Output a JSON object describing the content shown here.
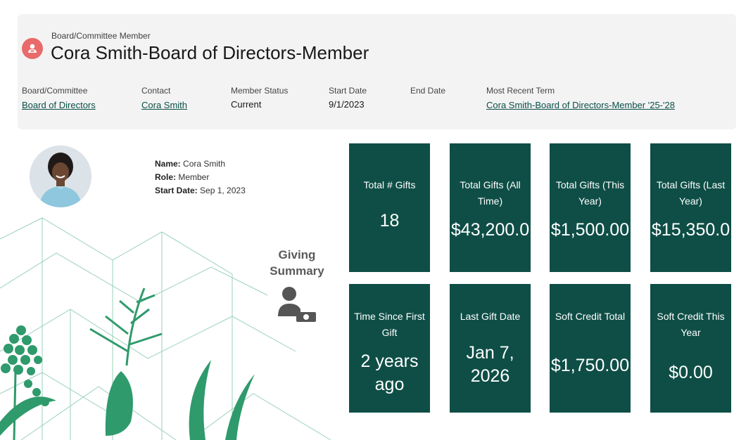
{
  "header": {
    "object_type": "Board/Committee Member",
    "title": "Cora Smith-Board of Directors-Member",
    "fields": [
      {
        "label": "Board/Committee",
        "value": "Board of Directors",
        "link": true
      },
      {
        "label": "Contact",
        "value": "Cora Smith",
        "link": true
      },
      {
        "label": "Member Status",
        "value": "Current",
        "link": false
      },
      {
        "label": "Start Date",
        "value": "9/1/2023",
        "link": false
      },
      {
        "label": "End Date",
        "value": "",
        "link": false
      },
      {
        "label": "Most Recent Term",
        "value": "Cora Smith-Board of Directors-Member '25-'28",
        "link": true
      }
    ]
  },
  "profile": {
    "name_label": "Name:",
    "name": "Cora Smith",
    "role_label": "Role:",
    "role": "Member",
    "start_label": "Start Date:",
    "start": "Sep 1, 2023"
  },
  "giving_summary": {
    "title_line1": "Giving",
    "title_line2": "Summary",
    "tiles": [
      {
        "label": "Total # Gifts",
        "value": "18"
      },
      {
        "label": "Total Gifts (All Time)",
        "value": "$43,200.0"
      },
      {
        "label": "Total Gifts (This Year)",
        "value": "$1,500.00"
      },
      {
        "label": "Total Gifts (Last Year)",
        "value": "$15,350.0"
      },
      {
        "label": "Time Since First Gift",
        "value": "2 years ago"
      },
      {
        "label": "Last Gift Date",
        "value": "Jan 7, 2026"
      },
      {
        "label": "Soft Credit Total",
        "value": "$1,750.00"
      },
      {
        "label": "Soft Credit This Year",
        "value": "$0.00"
      }
    ]
  },
  "colors": {
    "tile_bg": "#0e4e46",
    "link": "#0b4f47",
    "record_icon": "#e86a6a",
    "plant_green": "#2f9a6c"
  },
  "icons": {
    "record": "person-badge-icon",
    "giving": "person-money-icon"
  }
}
